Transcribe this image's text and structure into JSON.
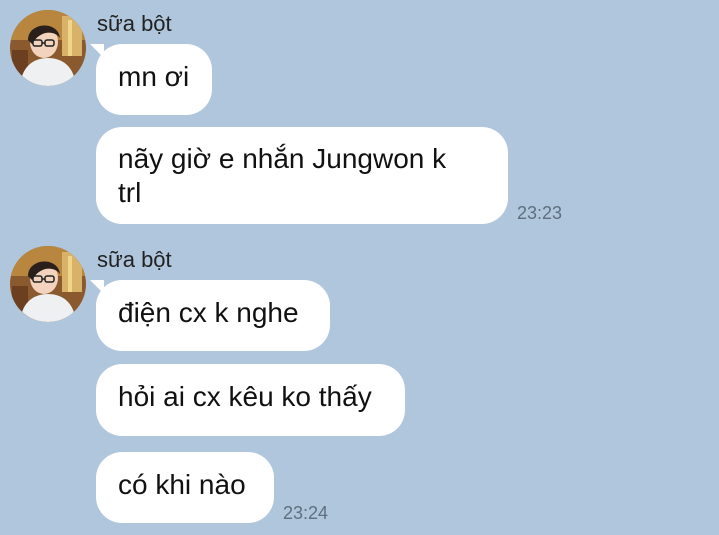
{
  "colors": {
    "background": "#b0c6dc",
    "bubble": "#ffffff",
    "timestamp": "#5f6f7e"
  },
  "groups": [
    {
      "sender": "sữa bột",
      "avatar_icon": "user-avatar",
      "messages": [
        "mn ơi",
        "nãy giờ e nhắn Jungwon k\ntrl"
      ],
      "time": "23:23"
    },
    {
      "sender": "sữa bột",
      "avatar_icon": "user-avatar",
      "messages": [
        "điện cx k nghe",
        "hỏi ai cx kêu ko thấy",
        "có khi nào"
      ],
      "time": "23:24"
    }
  ]
}
